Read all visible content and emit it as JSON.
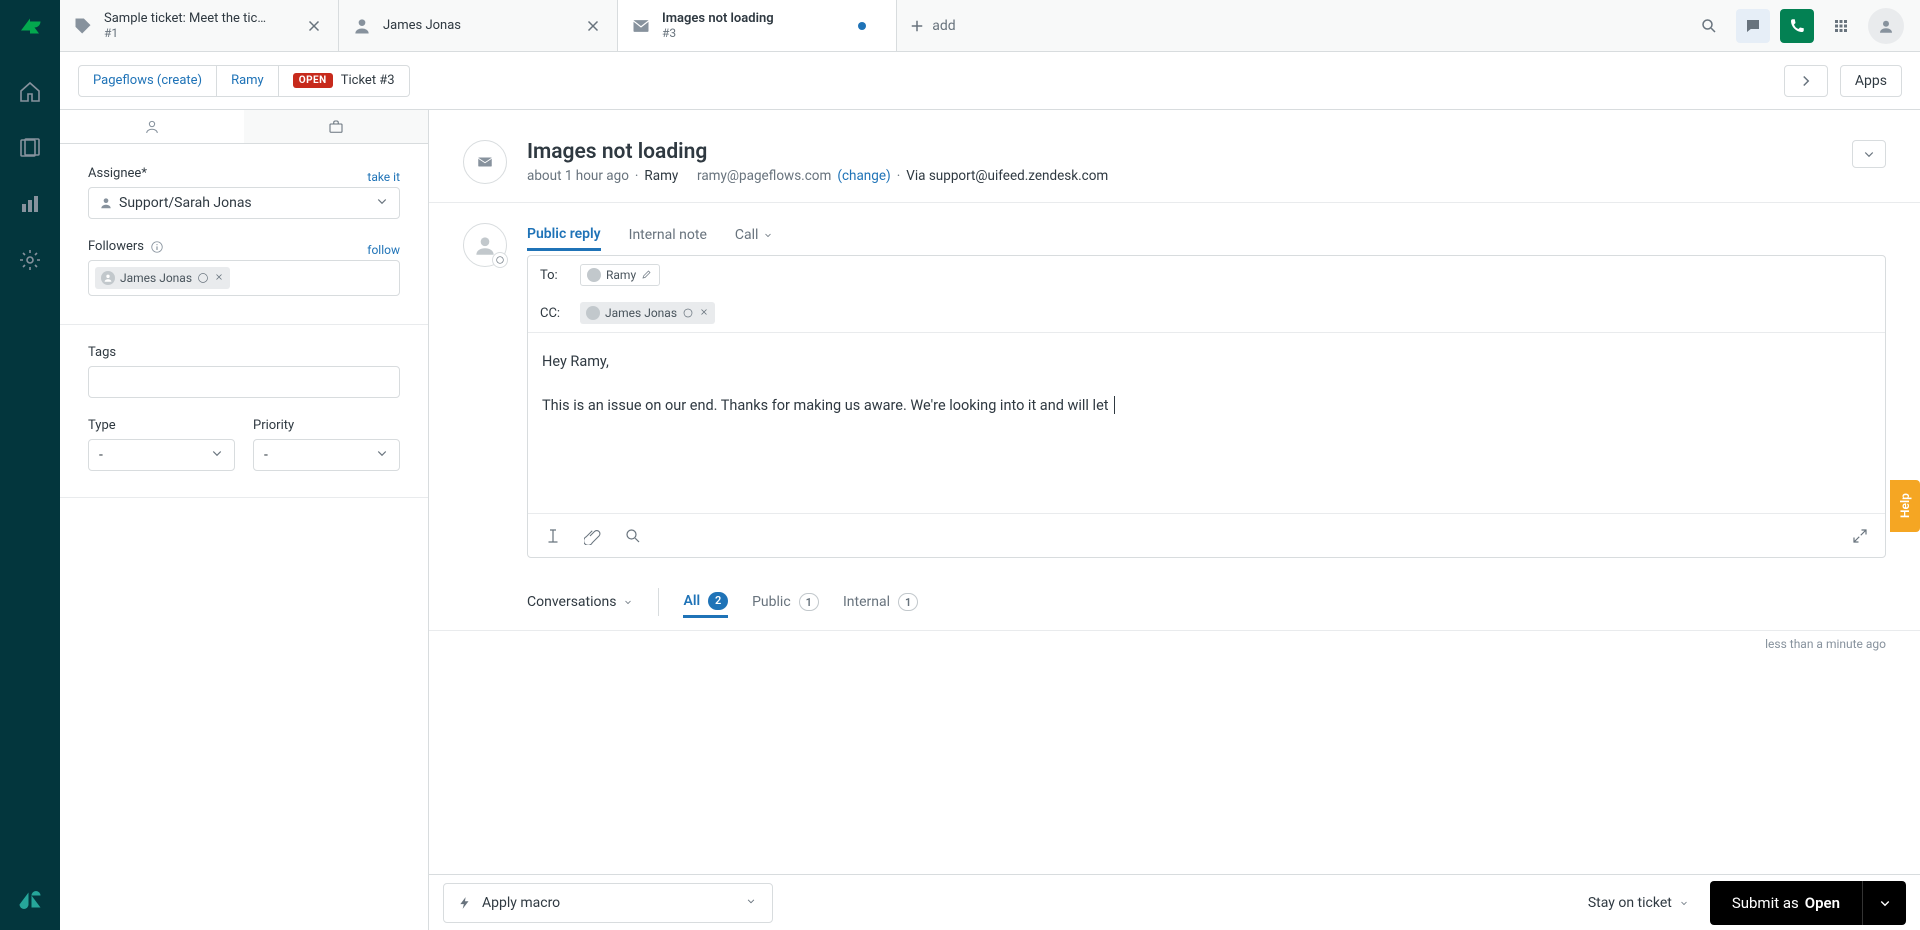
{
  "tabs": [
    {
      "title": "Sample ticket: Meet the tic…",
      "sub": "#1"
    },
    {
      "title": "James Jonas",
      "sub": ""
    },
    {
      "title": "Images not loading",
      "sub": "#3"
    }
  ],
  "add_label": "add",
  "breadcrumb": {
    "org": "Pageflows (create)",
    "requester": "Ramy",
    "status_badge": "OPEN",
    "ticket_ref": "Ticket #3"
  },
  "apps_label": "Apps",
  "sidebar": {
    "assignee_label": "Assignee*",
    "take_it": "take it",
    "assignee_value": "Support/Sarah Jonas",
    "followers_label": "Followers",
    "follow": "follow",
    "follower_pill": "James Jonas",
    "tags_label": "Tags",
    "type_label": "Type",
    "type_value": "-",
    "priority_label": "Priority",
    "priority_value": "-"
  },
  "ticket": {
    "title": "Images not loading",
    "time": "about 1 hour ago",
    "requester": "Ramy",
    "email": "ramy@pageflows.com",
    "change": "(change)",
    "via_label": "Via",
    "via_value": "support@uifeed.zendesk.com"
  },
  "composer": {
    "tab_public": "Public reply",
    "tab_internal": "Internal note",
    "tab_call": "Call",
    "to_label": "To:",
    "to_pill": "Ramy",
    "cc_label": "CC:",
    "cc_pill": "James Jonas",
    "body": "Hey Ramy,\n\nThis is an issue on our end. Thanks for making us aware. We're looking into it and will let "
  },
  "conversations": {
    "label": "Conversations",
    "all_label": "All",
    "all_count": "2",
    "public_label": "Public",
    "public_count": "1",
    "internal_label": "Internal",
    "internal_count": "1",
    "time": "less than a minute ago"
  },
  "bottom": {
    "macro": "Apply macro",
    "stay": "Stay on ticket",
    "submit_prefix": "Submit as ",
    "submit_status": "Open"
  },
  "help": "Help"
}
